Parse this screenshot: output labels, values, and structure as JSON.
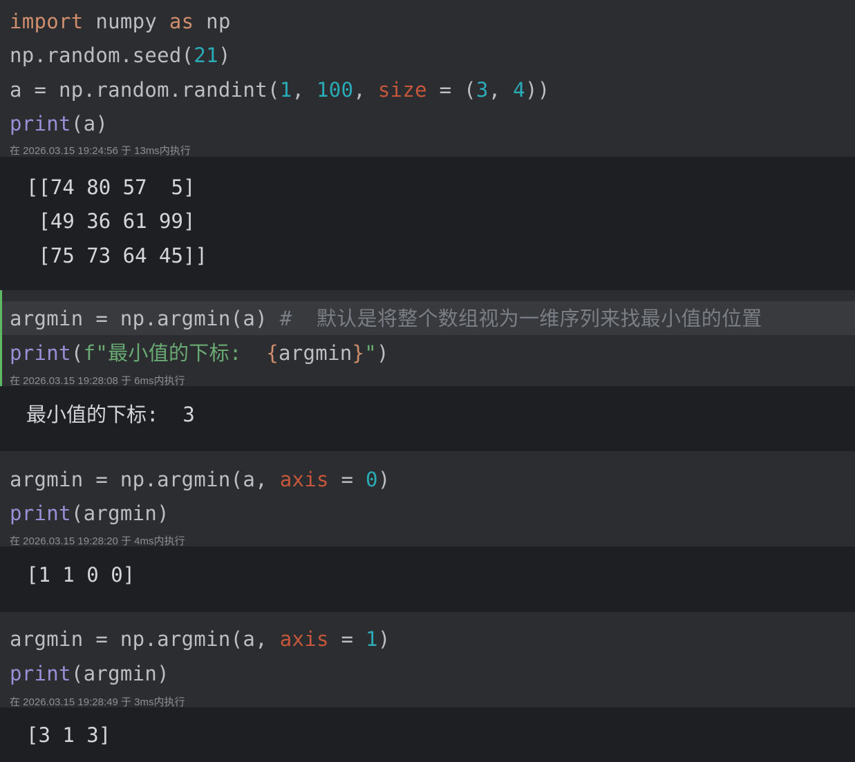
{
  "cells": [
    {
      "lines": [
        [
          {
            "t": "import",
            "c": "kw"
          },
          {
            "t": " numpy ",
            "c": "plain"
          },
          {
            "t": "as",
            "c": "kw"
          },
          {
            "t": " np",
            "c": "plain"
          }
        ],
        [
          {
            "t": "np.random.seed(",
            "c": "plain"
          },
          {
            "t": "21",
            "c": "num"
          },
          {
            "t": ")",
            "c": "plain"
          }
        ],
        [
          {
            "t": "a = np.random.randint(",
            "c": "plain"
          },
          {
            "t": "1",
            "c": "num"
          },
          {
            "t": ", ",
            "c": "plain"
          },
          {
            "t": "100",
            "c": "num"
          },
          {
            "t": ", ",
            "c": "plain"
          },
          {
            "t": "size",
            "c": "param"
          },
          {
            "t": " = (",
            "c": "plain"
          },
          {
            "t": "3",
            "c": "num"
          },
          {
            "t": ", ",
            "c": "plain"
          },
          {
            "t": "4",
            "c": "num"
          },
          {
            "t": "))",
            "c": "plain"
          }
        ],
        [
          {
            "t": "print",
            "c": "fn"
          },
          {
            "t": "(a)",
            "c": "plain"
          }
        ]
      ],
      "meta": "在 2026.03.15 19:24:56 于 13ms内执行",
      "output": [
        "[[74 80 57  5]",
        " [49 36 61 99]",
        " [75 73 64 45]]"
      ]
    },
    {
      "lines": [
        [
          {
            "t": "argmin = np.argmin(a) ",
            "c": "plain"
          },
          {
            "t": "#  默认是将整个数组视为一维序列来找最小值的位置",
            "c": "cmt"
          }
        ],
        [
          {
            "t": "print",
            "c": "fn"
          },
          {
            "t": "(",
            "c": "plain"
          },
          {
            "t": "f\"最小值的下标:  ",
            "c": "str"
          },
          {
            "t": "{",
            "c": "brace"
          },
          {
            "t": "argmin",
            "c": "plain"
          },
          {
            "t": "}",
            "c": "brace"
          },
          {
            "t": "\"",
            "c": "str"
          },
          {
            "t": ")",
            "c": "plain"
          }
        ]
      ],
      "meta": "在 2026.03.15 19:28:08 于 6ms内执行",
      "output": [
        "最小值的下标:  3"
      ]
    },
    {
      "lines": [
        [
          {
            "t": "argmin = np.argmin(a, ",
            "c": "plain"
          },
          {
            "t": "axis",
            "c": "param"
          },
          {
            "t": " = ",
            "c": "plain"
          },
          {
            "t": "0",
            "c": "num"
          },
          {
            "t": ")",
            "c": "plain"
          }
        ],
        [
          {
            "t": "print",
            "c": "fn"
          },
          {
            "t": "(argmin)",
            "c": "plain"
          }
        ]
      ],
      "meta": "在 2026.03.15 19:28:20 于 4ms内执行",
      "output": [
        "[1 1 0 0]"
      ]
    },
    {
      "lines": [
        [
          {
            "t": "argmin = np.argmin(a, ",
            "c": "plain"
          },
          {
            "t": "axis",
            "c": "param"
          },
          {
            "t": " = ",
            "c": "plain"
          },
          {
            "t": "1",
            "c": "num"
          },
          {
            "t": ")",
            "c": "plain"
          }
        ],
        [
          {
            "t": "print",
            "c": "fn"
          },
          {
            "t": "(argmin)",
            "c": "plain"
          }
        ]
      ],
      "meta": "在 2026.03.15 19:28:49 于 3ms内执行",
      "output": [
        "[3 1 3]"
      ]
    }
  ],
  "colors": {
    "keyword": "#cf8e6d",
    "function": "#9a8fd6",
    "number": "#2aacb8",
    "parameter": "#c6573a",
    "string": "#6aab73",
    "comment": "#7a7e85",
    "active_cell_bar": "#5fb865"
  }
}
